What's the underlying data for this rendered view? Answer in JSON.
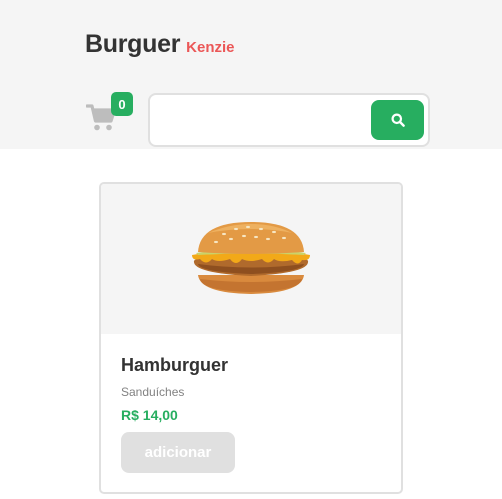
{
  "header": {
    "logo_main": "Burguer",
    "logo_sub": "Kenzie",
    "cart_count": "0",
    "cart_icon": "cart-icon",
    "search_icon": "search-icon",
    "search_value": "",
    "search_placeholder": ""
  },
  "colors": {
    "primary": "#27ae60",
    "secondary": "#eb5757",
    "gray_100": "#333333",
    "gray_50": "#828282",
    "gray_20": "#e0e0e0",
    "gray_0": "#f5f5f5"
  },
  "products": [
    {
      "name": "Hamburguer",
      "category": "Sanduíches",
      "price": "R$ 14,00",
      "button_label": "adicionar",
      "image_icon": "hamburger-image"
    }
  ]
}
